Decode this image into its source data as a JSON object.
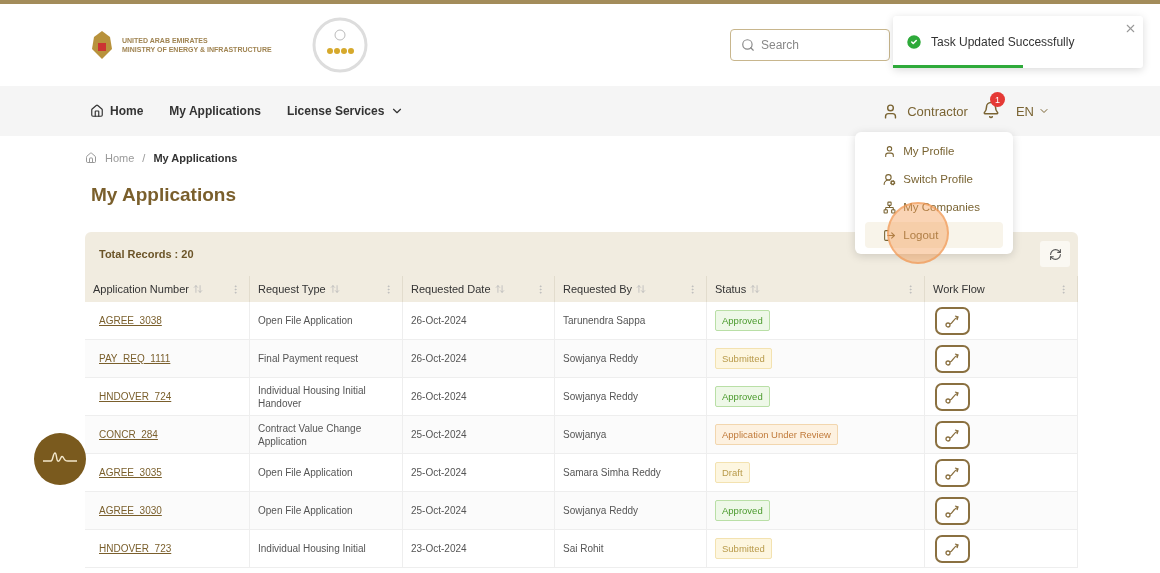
{
  "header": {
    "emblem_lines": [
      "UNITED ARAB EMIRATES",
      "MINISTRY OF ENERGY & INFRASTRUCTURE"
    ],
    "search": {
      "placeholder": "Search"
    }
  },
  "toast": {
    "message": "Task Updated Successfully",
    "level": 0.52
  },
  "nav": {
    "items": [
      {
        "label": "Home",
        "kind": "home"
      },
      {
        "label": "My Applications",
        "kind": "plain"
      },
      {
        "label": "License Services",
        "kind": "dropdown"
      }
    ],
    "user": "Contractor",
    "notifications": "1",
    "language": "EN"
  },
  "user_menu": {
    "items": [
      {
        "label": "My Profile",
        "kind": "profile",
        "selected": false
      },
      {
        "label": "Switch Profile",
        "kind": "switch",
        "selected": false
      },
      {
        "label": "My Companies",
        "kind": "companies",
        "selected": false
      },
      {
        "label": "Logout",
        "kind": "logout",
        "selected": true
      }
    ]
  },
  "breadcrumb": [
    "Home",
    "/",
    "My Applications"
  ],
  "title": "My Applications",
  "table": {
    "total": "Total Records : 20",
    "columns": [
      {
        "label": "Application Number",
        "sortable": true
      },
      {
        "label": "Request Type",
        "sortable": true
      },
      {
        "label": "Requested Date",
        "sortable": true
      },
      {
        "label": "Requested By",
        "sortable": true
      },
      {
        "label": "Status",
        "sortable": true
      },
      {
        "label": "Work Flow",
        "sortable": false
      }
    ],
    "rows": [
      {
        "number": "AGREE_3038",
        "type": "Open File Application",
        "date": "26-Oct-2024",
        "by": "Tarunendra Sappa",
        "status": "Approved",
        "kind": "approved"
      },
      {
        "number": "PAY_REQ_1111",
        "type": "Final Payment request",
        "date": "26-Oct-2024",
        "by": "Sowjanya Reddy",
        "status": "Submitted",
        "kind": "submitted"
      },
      {
        "number": "HNDOVER_724",
        "type": "Individual Housing Initial Handover",
        "date": "26-Oct-2024",
        "by": "Sowjanya Reddy",
        "status": "Approved",
        "kind": "approved"
      },
      {
        "number": "CONCR_284",
        "type": "Contract Value Change Application",
        "date": "25-Oct-2024",
        "by": "Sowjanya",
        "status": "Application Under Review",
        "kind": "review"
      },
      {
        "number": "AGREE_3035",
        "type": "Open File Application",
        "date": "25-Oct-2024",
        "by": "Samara Simha Reddy",
        "status": "Draft",
        "kind": "draft"
      },
      {
        "number": "AGREE_3030",
        "type": "Open File Application",
        "date": "25-Oct-2024",
        "by": "Sowjanya Reddy",
        "status": "Approved",
        "kind": "approved"
      },
      {
        "number": "HNDOVER_723",
        "type": "Individual Housing Initial",
        "date": "23-Oct-2024",
        "by": "Sai Rohit",
        "status": "Submitted",
        "kind": "submitted"
      }
    ]
  }
}
